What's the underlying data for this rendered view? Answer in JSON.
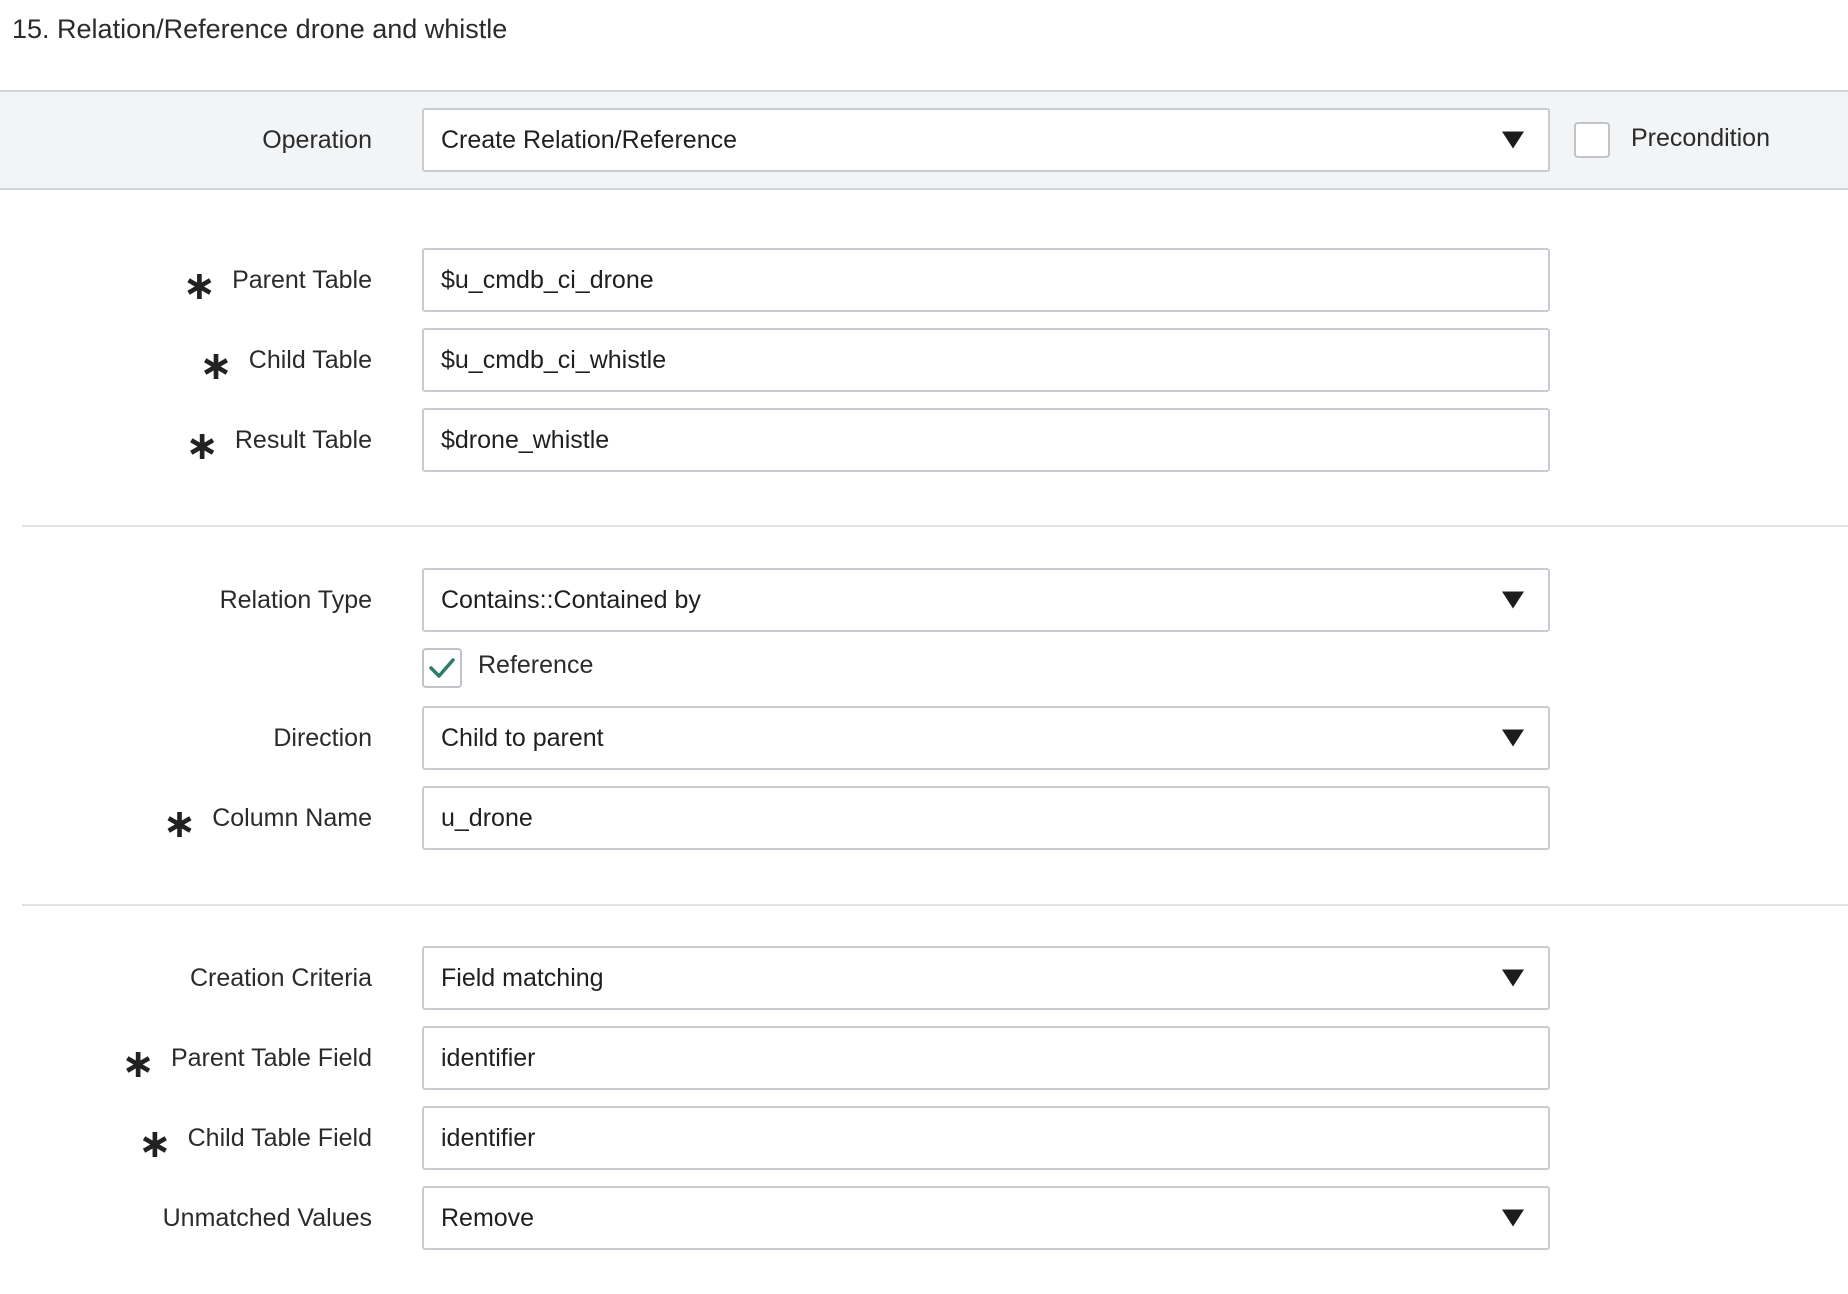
{
  "step": {
    "title": "15. Relation/Reference drone and whistle"
  },
  "operation": {
    "label": "Operation",
    "value": "Create Relation/Reference",
    "precondition_label": "Precondition",
    "precondition_checked": false
  },
  "tables": {
    "parent_label": "Parent Table",
    "parent_value": "$u_cmdb_ci_drone",
    "child_label": "Child Table",
    "child_value": "$u_cmdb_ci_whistle",
    "result_label": "Result Table",
    "result_value": "$drone_whistle"
  },
  "relation": {
    "type_label": "Relation Type",
    "type_value": "Contains::Contained by",
    "reference_label": "Reference",
    "reference_checked": true,
    "direction_label": "Direction",
    "direction_value": "Child to parent",
    "column_label": "Column Name",
    "column_value": "u_drone"
  },
  "criteria": {
    "creation_label": "Creation Criteria",
    "creation_value": "Field matching",
    "parent_field_label": "Parent Table Field",
    "parent_field_value": "identifier",
    "child_field_label": "Child Table Field",
    "child_field_value": "identifier",
    "unmatched_label": "Unmatched Values",
    "unmatched_value": "Remove"
  },
  "icons": {
    "required": "asterisk-icon",
    "dropdown": "caret-down-icon",
    "check": "checkmark-icon"
  },
  "colors": {
    "band_background": "#f2f4f6",
    "field_border": "#c9cdd1",
    "checkmark": "#2e7d6b",
    "text": "#2b2b2b"
  }
}
